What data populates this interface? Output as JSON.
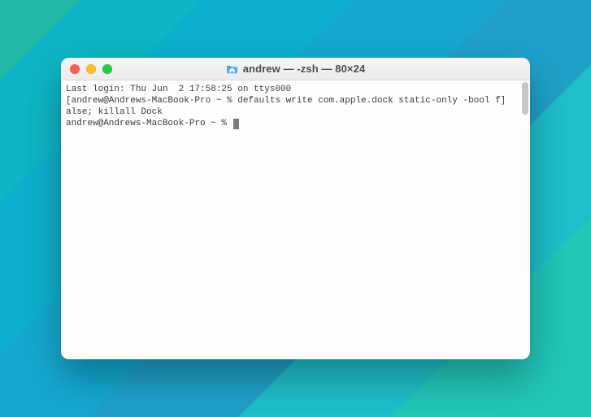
{
  "window": {
    "title": "andrew — -zsh — 80×24",
    "traffic_lights": {
      "close": "close",
      "minimize": "minimize",
      "zoom": "zoom"
    },
    "icon": "home-folder-icon"
  },
  "terminal": {
    "lines": [
      "Last login: Thu Jun  2 17:58:25 on ttys000",
      "[andrew@Andrews-MacBook-Pro ~ % defaults write com.apple.dock static-only -bool f]",
      "alse; killall Dock"
    ],
    "prompt": "andrew@Andrews-MacBook-Pro ~ % "
  }
}
